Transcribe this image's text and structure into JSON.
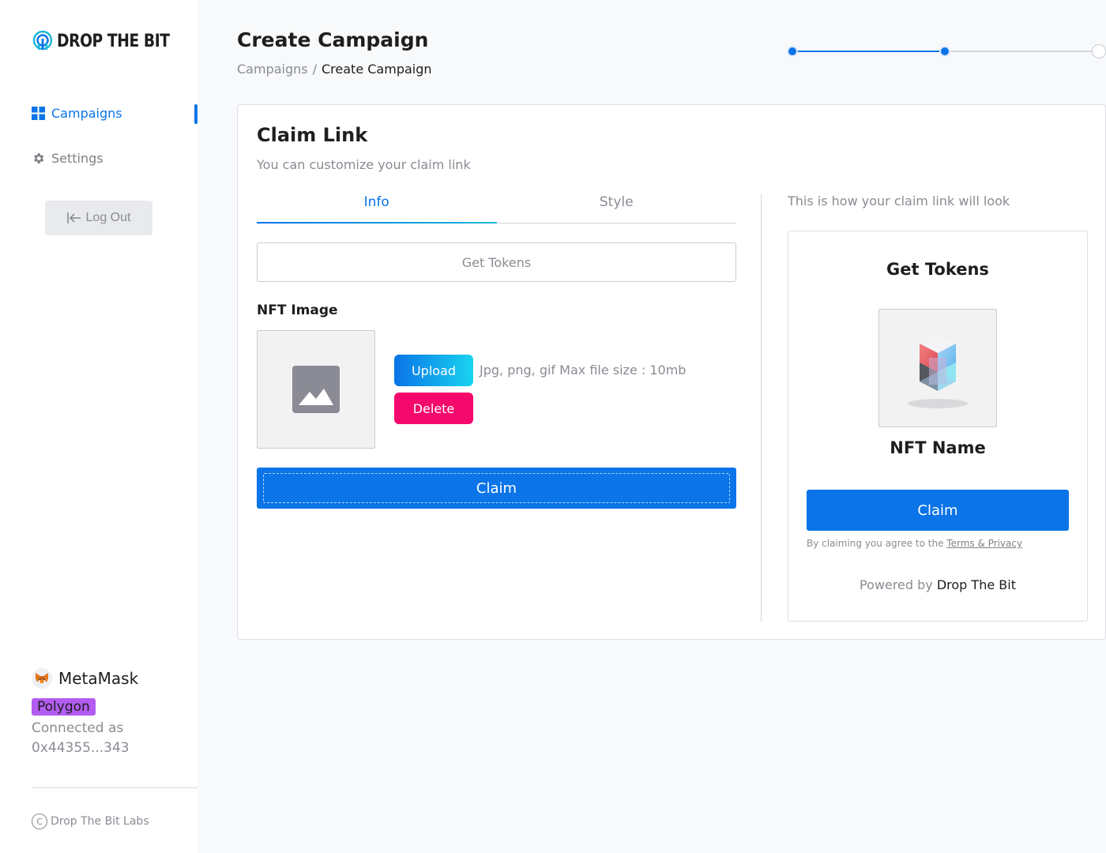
{
  "app": {
    "logo_text": "DROP THE BIT",
    "accent_color": "#0a74e8",
    "danger_color": "#f5086b"
  },
  "sidebar": {
    "items": [
      {
        "label": "Campaigns",
        "icon": "grid-icon",
        "active": true
      },
      {
        "label": "Settings",
        "icon": "gear-icon",
        "active": false
      }
    ],
    "logout_label": "Log Out",
    "wallet": {
      "name": "MetaMask",
      "network": "Polygon",
      "connected_label": "Connected as",
      "address": "0x44355...343"
    },
    "footer": "Drop The Bit Labs"
  },
  "header": {
    "title": "Create Campaign",
    "breadcrumb": {
      "parent": "Campaigns",
      "separator": "/",
      "current": "Create Campaign"
    },
    "stepper": {
      "total_steps": 3,
      "completed_steps": 2
    }
  },
  "card": {
    "title": "Claim Link",
    "subtitle": "You can customize your claim link",
    "tabs": [
      {
        "label": "Info",
        "active": true
      },
      {
        "label": "Style",
        "active": false
      }
    ],
    "title_input": {
      "value": "Get Tokens"
    },
    "nft_image_label": "NFT Image",
    "upload_label": "Upload",
    "delete_label": "Delete",
    "file_hint": "Jpg, png, gif Max file size : 10mb",
    "claim_label": "Claim"
  },
  "preview": {
    "caption": "This is how your claim link will look",
    "title": "Get Tokens",
    "nft_name": "NFT Name",
    "claim_label": "Claim",
    "terms_prefix": "By claiming you agree to the",
    "terms_link": "Terms & Privacy",
    "powered_prefix": "Powered by",
    "powered_brand": "Drop The Bit"
  }
}
